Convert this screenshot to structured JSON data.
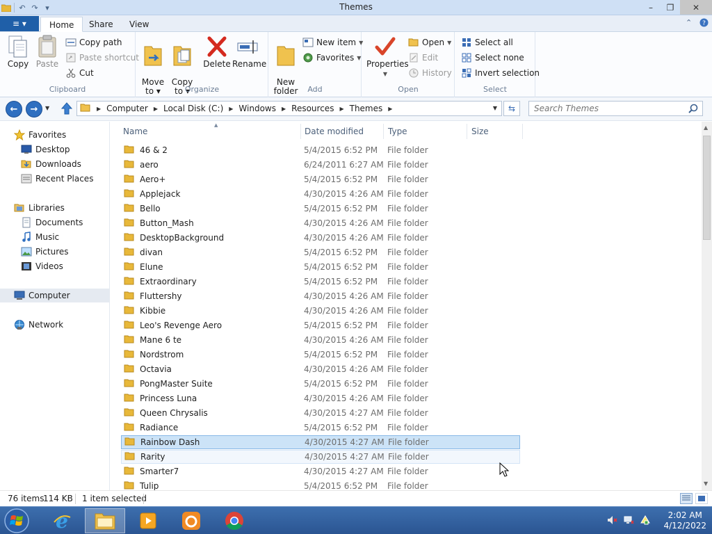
{
  "window": {
    "title": "Themes",
    "controls": {
      "minimize": "–",
      "maximize": "❐",
      "close": "✕"
    }
  },
  "ribbon_tabs": {
    "file": "≡ ▾",
    "home": "Home",
    "share": "Share",
    "view": "View"
  },
  "clipboard": {
    "label": "Clipboard",
    "copy": "Copy",
    "paste": "Paste",
    "copy_path": "Copy path",
    "paste_shortcut": "Paste shortcut",
    "cut": "Cut"
  },
  "organize": {
    "label": "Organize",
    "move_to": "Move\nto ▾",
    "copy_to": "Copy\nto ▾",
    "delete": "Delete",
    "rename": "Rename"
  },
  "add": {
    "label": "Add",
    "new_folder": "New\nfolder",
    "new_item": "New item",
    "favorites": "Favorites"
  },
  "open": {
    "label": "Open",
    "properties": "Properties",
    "open": "Open",
    "edit": "Edit",
    "history": "History"
  },
  "select": {
    "label": "Select",
    "select_all": "Select all",
    "select_none": "Select none",
    "invert_selection": "Invert selection"
  },
  "address_bar": {
    "breadcrumbs": [
      "Computer",
      "Local Disk (C:)",
      "Windows",
      "Resources",
      "Themes"
    ],
    "search_placeholder": "Search Themes"
  },
  "nav_pane": {
    "favorites": "Favorites",
    "desktop": "Desktop",
    "downloads": "Downloads",
    "recent_places": "Recent Places",
    "libraries": "Libraries",
    "documents": "Documents",
    "music": "Music",
    "pictures": "Pictures",
    "videos": "Videos",
    "computer": "Computer",
    "network": "Network"
  },
  "columns": {
    "name": "Name",
    "date_modified": "Date modified",
    "type": "Type",
    "size": "Size"
  },
  "files": [
    {
      "name": "46 & 2",
      "date": "5/4/2015 6:52 PM",
      "type": "File folder"
    },
    {
      "name": "aero",
      "date": "6/24/2011 6:27 AM",
      "type": "File folder"
    },
    {
      "name": "Aero+",
      "date": "5/4/2015 6:52 PM",
      "type": "File folder"
    },
    {
      "name": "Applejack",
      "date": "4/30/2015 4:26 AM",
      "type": "File folder"
    },
    {
      "name": "Bello",
      "date": "5/4/2015 6:52 PM",
      "type": "File folder"
    },
    {
      "name": "Button_Mash",
      "date": "4/30/2015 4:26 AM",
      "type": "File folder"
    },
    {
      "name": "DesktopBackground",
      "date": "4/30/2015 4:26 AM",
      "type": "File folder"
    },
    {
      "name": "divan",
      "date": "5/4/2015 6:52 PM",
      "type": "File folder"
    },
    {
      "name": "Elune",
      "date": "5/4/2015 6:52 PM",
      "type": "File folder"
    },
    {
      "name": "Extraordinary",
      "date": "5/4/2015 6:52 PM",
      "type": "File folder"
    },
    {
      "name": "Fluttershy",
      "date": "4/30/2015 4:26 AM",
      "type": "File folder"
    },
    {
      "name": "Kibbie",
      "date": "4/30/2015 4:26 AM",
      "type": "File folder"
    },
    {
      "name": "Leo's Revenge Aero",
      "date": "5/4/2015 6:52 PM",
      "type": "File folder"
    },
    {
      "name": "Mane 6 te",
      "date": "4/30/2015 4:26 AM",
      "type": "File folder"
    },
    {
      "name": "Nordstrom",
      "date": "5/4/2015 6:52 PM",
      "type": "File folder"
    },
    {
      "name": "Octavia",
      "date": "4/30/2015 4:26 AM",
      "type": "File folder"
    },
    {
      "name": "PongMaster Suite",
      "date": "5/4/2015 6:52 PM",
      "type": "File folder"
    },
    {
      "name": "Princess Luna",
      "date": "4/30/2015 4:26 AM",
      "type": "File folder"
    },
    {
      "name": "Queen Chrysalis",
      "date": "4/30/2015 4:27 AM",
      "type": "File folder"
    },
    {
      "name": "Radiance",
      "date": "5/4/2015 6:52 PM",
      "type": "File folder"
    },
    {
      "name": "Rainbow Dash",
      "date": "4/30/2015 4:27 AM",
      "type": "File folder"
    },
    {
      "name": "Rarity",
      "date": "4/30/2015 4:27 AM",
      "type": "File folder"
    },
    {
      "name": "Smarter7",
      "date": "4/30/2015 4:27 AM",
      "type": "File folder"
    },
    {
      "name": "Tulip",
      "date": "5/4/2015 6:52 PM",
      "type": "File folder"
    }
  ],
  "selected_file": "Rainbow Dash",
  "hovered_file": "Rarity",
  "status": {
    "items": "76 items",
    "size": "114 KB",
    "selection": "1 item selected"
  },
  "taskbar": {
    "time": "2:02 AM",
    "date": "4/12/2022"
  },
  "colors": {
    "accent": "#1f5fa8",
    "selection": "#cce3f7",
    "taskbar": "#2b5592",
    "folder": "#e8b83a"
  }
}
